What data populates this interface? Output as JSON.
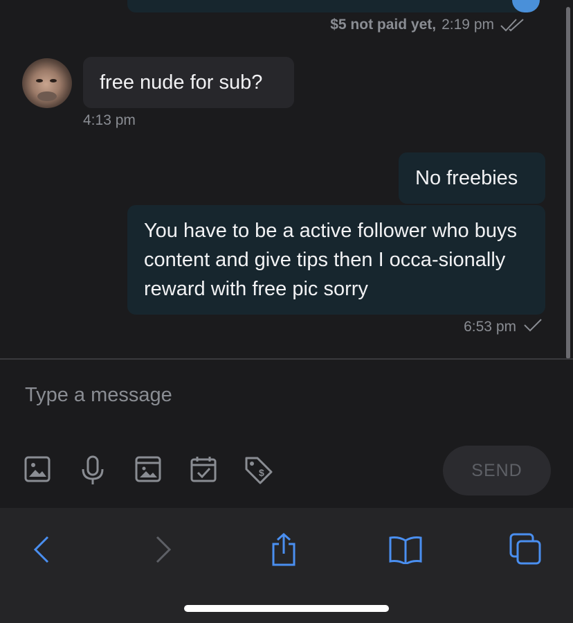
{
  "chat": {
    "previous_message_meta": {
      "status": "$5 not paid yet,",
      "time": "2:19 pm"
    },
    "incoming": {
      "text": "free nude for sub?",
      "time": "4:13 pm"
    },
    "outgoing": [
      {
        "text": "No freebies"
      },
      {
        "text": "You have to be a active follower who buys content and give tips then I occa-sionally reward with free pic sorry"
      }
    ],
    "outgoing_time": "6:53 pm"
  },
  "composer": {
    "placeholder": "Type a message",
    "value": "",
    "send_label": "SEND",
    "tools": [
      "image-icon",
      "microphone-icon",
      "gallery-icon",
      "calendar-icon",
      "price-tag-icon"
    ]
  },
  "browser_toolbar": {
    "buttons": [
      "back-icon",
      "forward-icon",
      "share-icon",
      "bookmarks-icon",
      "tabs-icon"
    ]
  },
  "colors": {
    "accent": "#4a90d9",
    "incoming_bubble": "#27272b",
    "outgoing_bubble": "#17262e",
    "background": "#1b1b1d"
  }
}
